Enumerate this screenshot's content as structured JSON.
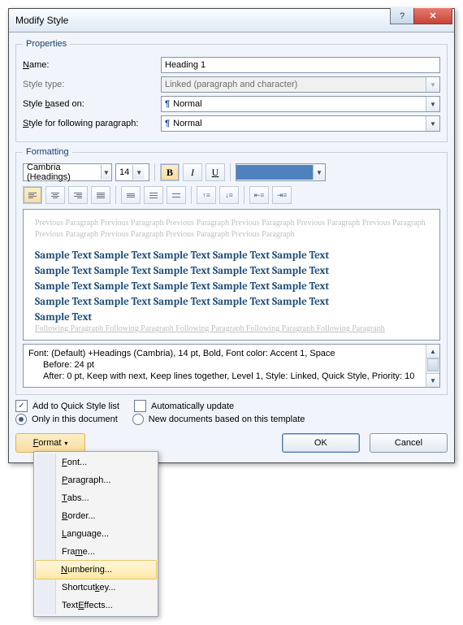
{
  "window": {
    "title": "Modify Style"
  },
  "properties": {
    "legend": "Properties",
    "name_label": "Name:",
    "name_value": "Heading 1",
    "type_label": "Style type:",
    "type_value": "Linked (paragraph and character)",
    "based_label": "Style based on:",
    "based_value": "Normal",
    "following_label": "Style for following paragraph:",
    "following_value": "Normal"
  },
  "formatting": {
    "legend": "Formatting",
    "font_name": "Cambria (Headings)",
    "font_size": "14",
    "bold": "B",
    "italic": "I",
    "underline": "U",
    "swatch_color": "#4f81bd",
    "preview_prev": "Previous Paragraph Previous Paragraph Previous Paragraph Previous Paragraph Previous Paragraph Previous Paragraph Previous Paragraph Previous Paragraph Previous Paragraph Previous Paragraph",
    "sample_line": "Sample Text Sample Text Sample Text Sample Text Sample Text",
    "preview_next": "Following Paragraph Following Paragraph Following Paragraph Following Paragraph Following Paragraph",
    "description": {
      "l1": "Font: (Default) +Headings (Cambria), 14 pt, Bold, Font color: Accent 1, Space",
      "l2": "Before:  24 pt",
      "l3": "After:  0 pt, Keep with next, Keep lines together, Level 1, Style: Linked, Quick Style, Priority: 10"
    }
  },
  "options": {
    "quick_style": "Add to Quick Style list",
    "auto_update": "Automatically update",
    "only_doc": "Only in this document",
    "new_docs": "New documents based on this template"
  },
  "buttons": {
    "format": "Format",
    "ok": "OK",
    "cancel": "Cancel"
  },
  "format_menu": {
    "font": "Font...",
    "paragraph": "Paragraph...",
    "tabs": "Tabs...",
    "border": "Border...",
    "language": "Language...",
    "frame": "Frame...",
    "numbering": "Numbering...",
    "shortcut": "Shortcut key...",
    "effects": "Text Effects..."
  }
}
